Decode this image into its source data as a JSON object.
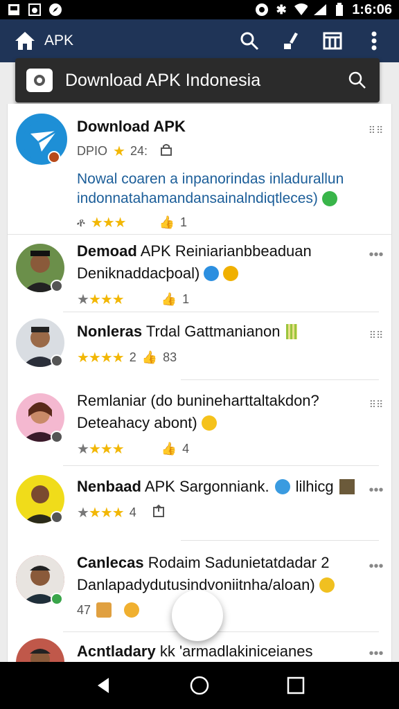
{
  "status_bar": {
    "time": "1:6:06"
  },
  "app_bar": {
    "title": "APK"
  },
  "search": {
    "query": "Download APK Indonesia"
  },
  "featured": {
    "title": "Download APK",
    "sub_label": "DPIO",
    "rating_text": "24:",
    "description_line1": "Nowal coaren a inpanorindas inladurallun",
    "description_line2": "indonnatahamandansainalndiqtleces)",
    "likes": "1",
    "prefix": "ቶ"
  },
  "list": [
    {
      "bold": "Demoad",
      "rest": " APK Reiniarianbbeaduan",
      "line2": "Deniknaddacþoal)",
      "count_left": "",
      "likes": "1"
    },
    {
      "bold": "Nonleras",
      "rest": " Trdal Gattmanianon",
      "line2": "",
      "count_left": "2",
      "likes": "83"
    },
    {
      "bold": "",
      "rest": "Remlaniar (do bunineharttaltakdon?",
      "line2": "Deteahacy abont)",
      "count_left": "",
      "likes": "4"
    },
    {
      "bold": "Nenbaad",
      "rest": " APK Sargonniank.",
      "line2": "",
      "count_left": "4",
      "likes": "",
      "suffix": "lilhicg"
    },
    {
      "bold": "Canlecas",
      "rest": " Rodaim Sadunietatdadar 2",
      "line2": "Danlapadydutusindvoniitnha/aloan)",
      "count_left": "47",
      "likes": ""
    },
    {
      "bold": "Acntladary",
      "rest": " kk 'armadlakiniceianes",
      "line2": "",
      "count_left": "",
      "likes": ""
    }
  ],
  "colors": {
    "app_bar": "#1f3457",
    "star": "#f2b705",
    "link_text": "#1c5e99",
    "featured_icon": "#1e8fd6"
  }
}
